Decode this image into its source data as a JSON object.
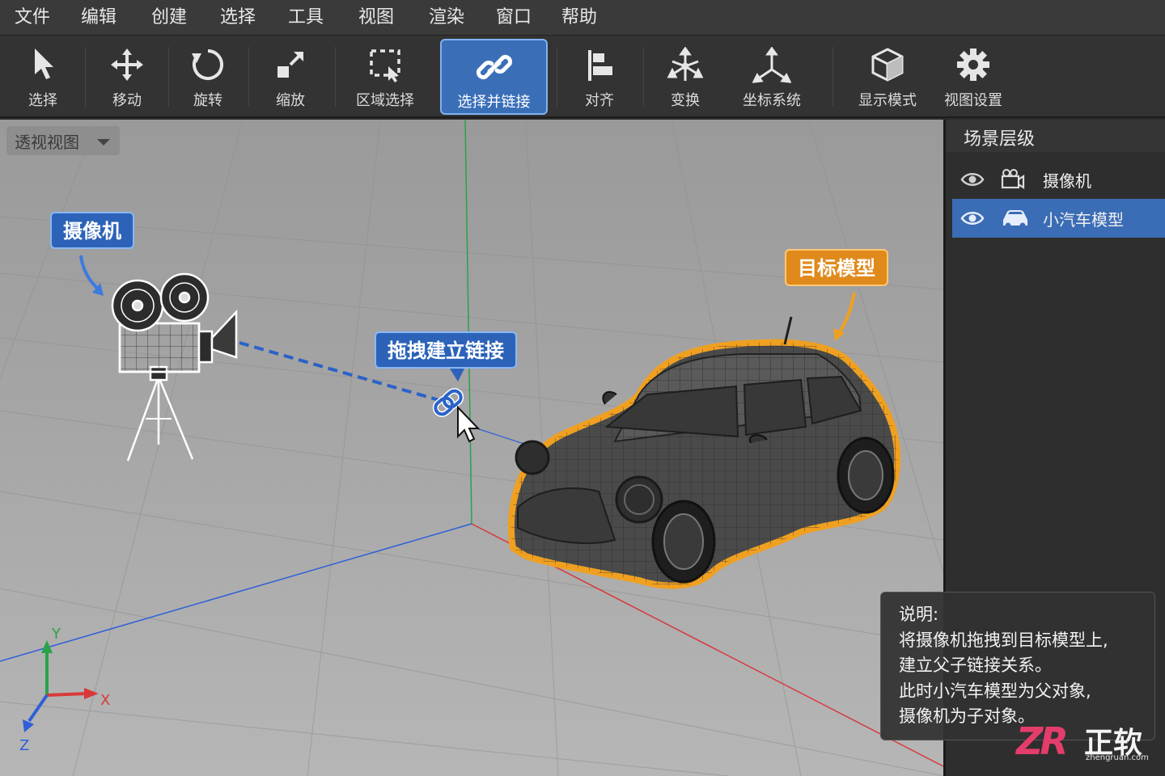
{
  "menu": [
    "文件",
    "编辑",
    "创建",
    "选择",
    "工具",
    "视图",
    "渲染",
    "窗口",
    "帮助"
  ],
  "toolbar": [
    {
      "label": "选择",
      "icon": "pointer-icon"
    },
    {
      "label": "移动",
      "icon": "move-icon"
    },
    {
      "label": "旋转",
      "icon": "rotate-icon"
    },
    {
      "label": "缩放",
      "icon": "scale-icon"
    },
    {
      "label": "区域选择",
      "icon": "region-select-icon"
    },
    {
      "label": "选择并链接",
      "icon": "link-icon",
      "active": true
    },
    {
      "label": "对齐",
      "icon": "align-icon"
    },
    {
      "label": "变换",
      "icon": "transform-icon"
    },
    {
      "label": "坐标系统",
      "icon": "axis-icon"
    },
    {
      "label": "显示模式",
      "icon": "cube-icon"
    },
    {
      "label": "视图设置",
      "icon": "gear-icon"
    }
  ],
  "viewport": {
    "view_mode": "透视视图",
    "labels": {
      "camera": "摄像机",
      "target": "目标模型",
      "drag": "拖拽建立链接"
    },
    "axes": {
      "x": "X",
      "y": "Y",
      "z": "Z"
    }
  },
  "outliner": {
    "title": "场景层级",
    "items": [
      {
        "label": "摄像机",
        "icon": "camera-icon",
        "selected": false
      },
      {
        "label": "小汽车模型",
        "icon": "car-icon",
        "selected": true
      }
    ]
  },
  "note": {
    "lines": [
      "说明:",
      "将摄像机拖拽到目标模型上,",
      "建立父子链接关系。",
      "此时小汽车模型为父对象,",
      "摄像机为子对象。"
    ]
  },
  "watermark": {
    "logo": "ZR",
    "name": "正软",
    "url": "zhengruan.com"
  },
  "colors": {
    "accent": "#3a6fb8",
    "highlight": "#f0a020",
    "link_line": "#2a62c8"
  }
}
